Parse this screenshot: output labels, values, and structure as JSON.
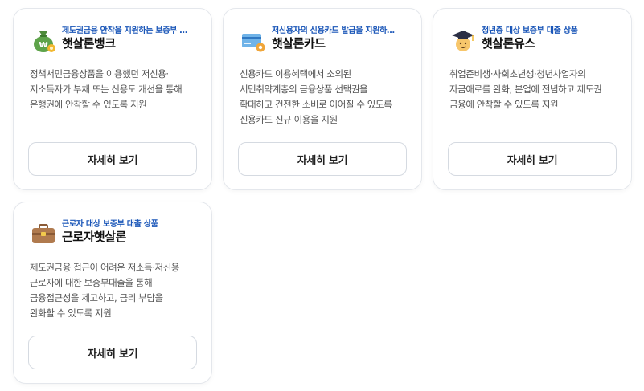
{
  "cards": [
    {
      "subtitle": "제도권금융 안착을 지원하는 보증부 …",
      "title": "햇살론뱅크",
      "desc": [
        "정책서민금융상품을 이용했던 저신용·",
        "저소득자가 부채 또는 신용도 개선을 통해",
        "은행권에 안착할 수 있도록 지원"
      ],
      "button": "자세히 보기",
      "icon": "money-bag-icon"
    },
    {
      "subtitle": "저신용자의 신용카드 발급을 지원하…",
      "title": "햇살론카드",
      "desc": [
        "신용카드 이용혜택에서 소외된",
        "서민취약계층의 금융상품 선택권을",
        "확대하고 건전한 소비로 이어질 수 있도록",
        "신용카드 신규 이용을 지원"
      ],
      "button": "자세히 보기",
      "icon": "credit-card-icon"
    },
    {
      "subtitle": "청년층 대상 보증부 대출 상품",
      "title": "햇살론유스",
      "desc": [
        "취업준비생·사회초년생·청년사업자의",
        "자금애로를 완화, 본업에 전념하고 제도권",
        "금융에 안착할 수 있도록 지원"
      ],
      "button": "자세히 보기",
      "icon": "graduate-icon"
    },
    {
      "subtitle": "근로자 대상 보증부 대출 상품",
      "title": "근로자햇살론",
      "desc": [
        "제도권금융 접근이 어려운 저소득·저신용",
        "근로자에 대한 보증부대출을 통해",
        "금융접근성을 제고하고, 금리 부담을",
        "완화할 수 있도록 지원"
      ],
      "button": "자세히 보기",
      "icon": "briefcase-icon"
    }
  ],
  "colors": {
    "accent": "#1a56b8",
    "border": "#e4e7ec"
  }
}
